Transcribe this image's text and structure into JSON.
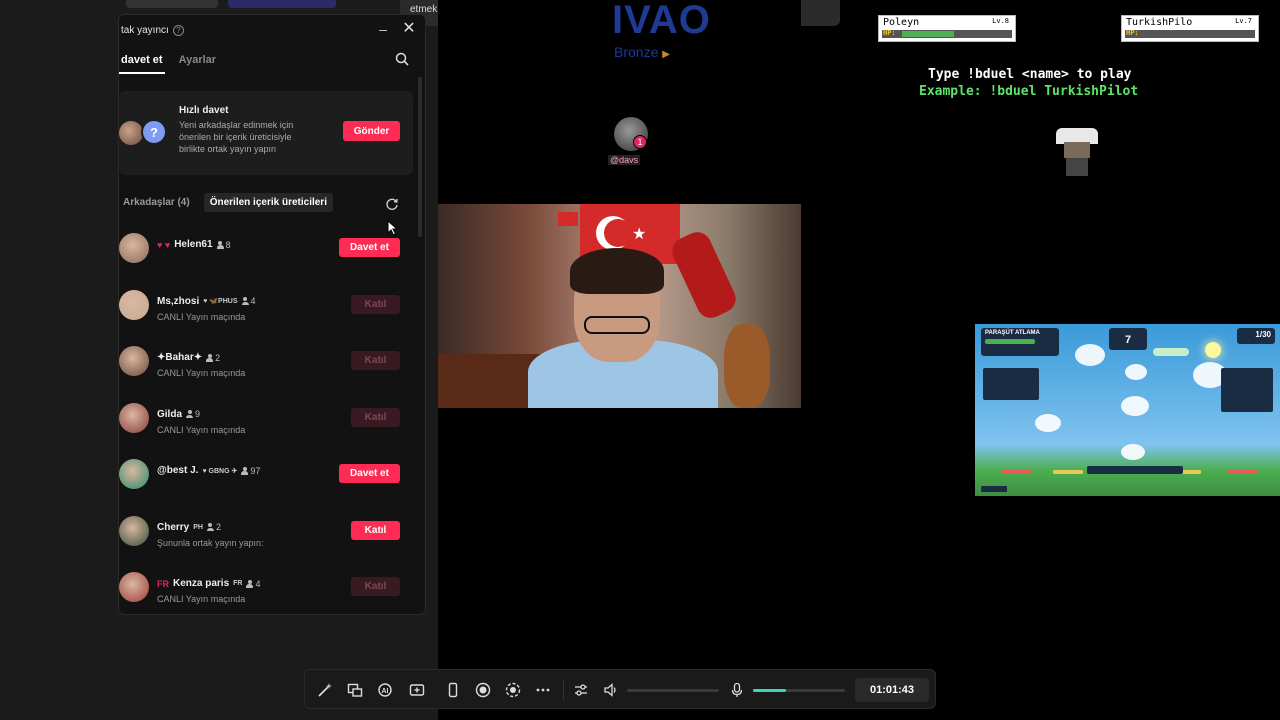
{
  "notice": {
    "text": "etmek için ses ayarlarını açın."
  },
  "panel": {
    "title": "tak yayıncı",
    "tabs": [
      {
        "label": "davet et",
        "active": true
      },
      {
        "label": "Ayarlar",
        "active": false
      }
    ],
    "quick_invite": {
      "title": "Hızlı davet",
      "description": "Yeni arkadaşlar edinmek için önerilen bir içerik üreticisiyle birlikte ortak yayın yapın",
      "button": "Gönder",
      "avatar_badge": "?"
    },
    "subtabs": [
      {
        "label": "Arkadaşlar (4)",
        "active": false
      },
      {
        "label": "Önerilen içerik üreticileri",
        "active": true
      }
    ],
    "creators": [
      {
        "name": "Helen61",
        "prefix": "♥ ♥",
        "count": "8",
        "status": "",
        "button": "Davet et",
        "button_state": "primary",
        "avatar_color": "#8a6a5a"
      },
      {
        "name": "Ms,zhosi",
        "prefix": "",
        "suffix": "♥ 🦋PHUS",
        "count": "4",
        "status": "CANLI Yayın maçında",
        "button": "Katıl",
        "button_state": "disabled",
        "avatar_color": "#c9a890"
      },
      {
        "name": "✦Bahar✦",
        "prefix": "",
        "suffix": "",
        "count": "2",
        "status": "CANLI Yayın maçında",
        "button": "Katıl",
        "button_state": "disabled",
        "avatar_color": "#6a4a3a"
      },
      {
        "name": "Gilda",
        "prefix": "",
        "suffix": "",
        "count": "9",
        "status": "CANLI Yayın maçında",
        "button": "Katıl",
        "button_state": "disabled",
        "avatar_color": "#8a3a3a"
      },
      {
        "name": "@best J.",
        "prefix": "",
        "suffix": "♥ GBNG ✈",
        "count": "97",
        "status": "",
        "button": "Davet et",
        "button_state": "primary",
        "avatar_color": "#2a8a6a"
      },
      {
        "name": "Cherry",
        "prefix": "",
        "suffix": "PH",
        "count": "2",
        "status": "Şununla ortak yayın yapın:",
        "button": "Katıl",
        "button_state": "primary",
        "avatar_color": "#3a4a3a"
      },
      {
        "name": "Kenza paris",
        "prefix": "FR",
        "suffix": "FR",
        "count": "4",
        "status": "CANLI Yayın maçında",
        "button": "Katıl",
        "button_state": "disabled",
        "avatar_color": "#a03a3a"
      }
    ]
  },
  "stream": {
    "logo": "IVAO",
    "rank": "Bronze",
    "badge_count": "1",
    "viewer_name": "@davs"
  },
  "game": {
    "players": [
      {
        "name": "Poleyn",
        "level": "Lv.8",
        "hp_label": "HP:",
        "hp_fraction": 0.47
      },
      {
        "name": "TurkishPilo",
        "level": "Lv.7",
        "hp_label": "HP:",
        "hp_fraction": 0.0
      }
    ],
    "instruction": "Type !bduel <name> to play",
    "example": "Example: !bduel TurkishPilot"
  },
  "parachute": {
    "title": "PARAŞÜT ATLAMA",
    "count": "7",
    "round": "1/30"
  },
  "toolbar": {
    "icons": [
      "magic-wand-icon",
      "layout-icon",
      "ai-icon",
      "add-source-icon",
      "phone-icon",
      "record-icon",
      "target-icon",
      "more-icon",
      "sliders-icon",
      "speaker-icon",
      "microphone-icon"
    ],
    "mic_level": 0.36,
    "timer": "01:01:43"
  },
  "colors": {
    "accent": "#fe2c55",
    "disabled_button": "#3a1a22",
    "mic_level": "#3ed6b2",
    "ivao_blue": "#1f3a93"
  }
}
